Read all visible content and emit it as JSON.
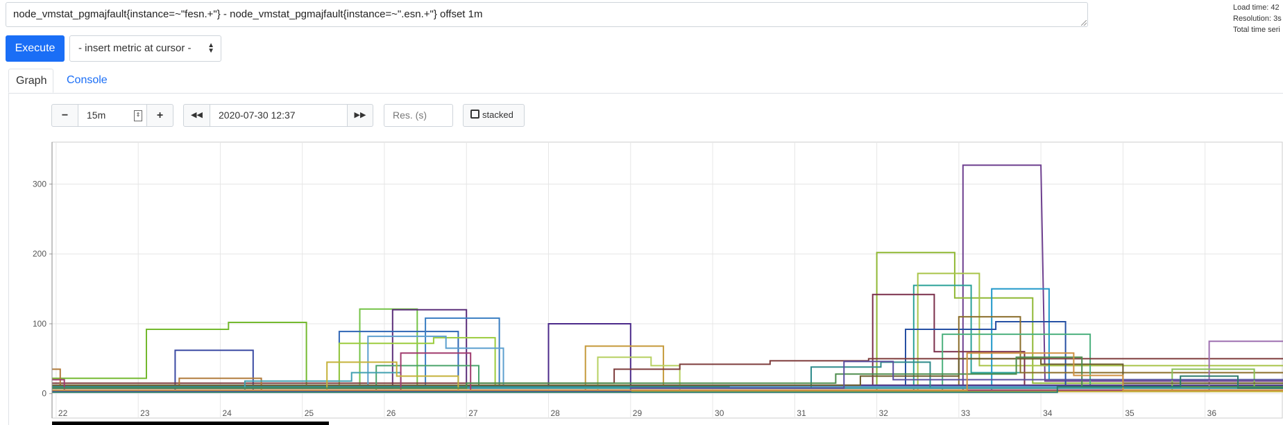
{
  "query": {
    "text": "node_vmstat_pgmajfault{instance=~\"fesn.+\"} - node_vmstat_pgmajfault{instance=~\".esn.+\"} offset 1m"
  },
  "stats": {
    "load_time": "Load time: 42",
    "resolution": "Resolution: 3s",
    "total_series": "Total time seri"
  },
  "toolbar": {
    "execute_label": "Execute",
    "insert_metric": "- insert metric at cursor -"
  },
  "tabs": [
    {
      "label": "Graph",
      "active": true
    },
    {
      "label": "Console",
      "active": false
    }
  ],
  "controls": {
    "minus": "−",
    "range": "15m",
    "plus": "+",
    "back": "◀◀",
    "end_time": "2020-07-30 12:37",
    "forward": "▶▶",
    "resolution_placeholder": "Res. (s)",
    "stacked_label": "stacked"
  },
  "colors": {
    "accent": "#1a6ef6",
    "grid": "#e6e6e6"
  },
  "chart_data": {
    "type": "line",
    "x_ticks": [
      "22",
      "23",
      "24",
      "25",
      "26",
      "27",
      "28",
      "29",
      "30",
      "31",
      "32",
      "33",
      "34",
      "35",
      "36"
    ],
    "y_ticks": [
      "0",
      "100",
      "200",
      "300"
    ],
    "xlim": [
      21.95,
      36.95
    ],
    "ylim": [
      -35,
      360
    ],
    "grid": true,
    "series": [
      {
        "color": "#6e3f8f",
        "points": [
          [
            21.95,
            3
          ],
          [
            32.9,
            3
          ],
          [
            33.05,
            3
          ],
          [
            33.05,
            327
          ],
          [
            34.0,
            327
          ],
          [
            34.05,
            18
          ],
          [
            36.95,
            18
          ]
        ]
      },
      {
        "color": "#8fb833",
        "points": [
          [
            21.95,
            3
          ],
          [
            32.0,
            3
          ],
          [
            32.0,
            202
          ],
          [
            32.95,
            202
          ],
          [
            32.95,
            137
          ],
          [
            33.9,
            137
          ],
          [
            33.9,
            15
          ],
          [
            36.95,
            15
          ]
        ]
      },
      {
        "color": "#2aa198",
        "points": [
          [
            21.95,
            5
          ],
          [
            32.45,
            5
          ],
          [
            32.45,
            155
          ],
          [
            33.15,
            155
          ],
          [
            33.15,
            30
          ],
          [
            36.95,
            30
          ]
        ]
      },
      {
        "color": "#a8c448",
        "points": [
          [
            21.95,
            5
          ],
          [
            32.5,
            5
          ],
          [
            32.5,
            172
          ],
          [
            33.25,
            172
          ],
          [
            33.25,
            40
          ],
          [
            36.95,
            40
          ]
        ]
      },
      {
        "color": "#1f97c9",
        "points": [
          [
            21.95,
            5
          ],
          [
            33.4,
            5
          ],
          [
            33.4,
            150
          ],
          [
            34.1,
            150
          ],
          [
            34.1,
            20
          ],
          [
            36.95,
            20
          ]
        ]
      },
      {
        "color": "#7a2e4a",
        "points": [
          [
            21.95,
            8
          ],
          [
            31.95,
            8
          ],
          [
            31.95,
            142
          ],
          [
            32.7,
            142
          ],
          [
            32.7,
            60
          ],
          [
            33.8,
            60
          ],
          [
            33.8,
            10
          ],
          [
            36.95,
            10
          ]
        ]
      },
      {
        "color": "#2650a3",
        "points": [
          [
            21.95,
            10
          ],
          [
            32.35,
            10
          ],
          [
            32.35,
            92
          ],
          [
            33.45,
            92
          ],
          [
            33.45,
            103
          ],
          [
            34.3,
            103
          ],
          [
            34.3,
            10
          ],
          [
            36.95,
            10
          ]
        ]
      },
      {
        "color": "#8a6d2a",
        "points": [
          [
            21.95,
            8
          ],
          [
            33.0,
            8
          ],
          [
            33.0,
            110
          ],
          [
            33.75,
            110
          ],
          [
            33.75,
            30
          ],
          [
            36.95,
            30
          ]
        ]
      },
      {
        "color": "#4bb07d",
        "points": [
          [
            21.95,
            5
          ],
          [
            32.8,
            5
          ],
          [
            32.8,
            85
          ],
          [
            34.6,
            85
          ],
          [
            34.6,
            12
          ],
          [
            36.95,
            12
          ]
        ]
      },
      {
        "color": "#73b92e",
        "points": [
          [
            21.95,
            22
          ],
          [
            23.1,
            22
          ],
          [
            23.1,
            92
          ],
          [
            24.1,
            92
          ],
          [
            24.1,
            102
          ],
          [
            25.05,
            102
          ],
          [
            25.05,
            8
          ],
          [
            36.95,
            8
          ]
        ]
      },
      {
        "color": "#3a4aa3",
        "points": [
          [
            21.95,
            5
          ],
          [
            23.45,
            5
          ],
          [
            23.45,
            62
          ],
          [
            24.4,
            62
          ],
          [
            24.4,
            5
          ],
          [
            36.95,
            5
          ]
        ]
      },
      {
        "color": "#74c346",
        "points": [
          [
            21.95,
            8
          ],
          [
            25.7,
            8
          ],
          [
            25.7,
            121
          ],
          [
            26.4,
            121
          ],
          [
            26.4,
            10
          ],
          [
            36.95,
            10
          ]
        ]
      },
      {
        "color": "#5b2e7a",
        "points": [
          [
            21.95,
            8
          ],
          [
            26.1,
            8
          ],
          [
            26.1,
            120
          ],
          [
            27.0,
            120
          ],
          [
            27.0,
            10
          ],
          [
            36.95,
            10
          ]
        ]
      },
      {
        "color": "#2f66b5",
        "points": [
          [
            21.95,
            8
          ],
          [
            25.45,
            8
          ],
          [
            25.45,
            89
          ],
          [
            26.9,
            89
          ],
          [
            26.9,
            10
          ],
          [
            36.95,
            10
          ]
        ]
      },
      {
        "color": "#3a7ec2",
        "points": [
          [
            21.95,
            10
          ],
          [
            26.5,
            10
          ],
          [
            26.5,
            108
          ],
          [
            27.4,
            108
          ],
          [
            27.4,
            10
          ],
          [
            36.95,
            10
          ]
        ]
      },
      {
        "color": "#9bcc3c",
        "points": [
          [
            21.95,
            10
          ],
          [
            25.45,
            10
          ],
          [
            25.45,
            72
          ],
          [
            26.6,
            72
          ],
          [
            26.6,
            80
          ],
          [
            27.35,
            80
          ],
          [
            27.35,
            12
          ],
          [
            36.95,
            12
          ]
        ]
      },
      {
        "color": "#4b2a8a",
        "points": [
          [
            21.95,
            8
          ],
          [
            28.0,
            8
          ],
          [
            28.0,
            100
          ],
          [
            29.0,
            100
          ],
          [
            29.0,
            12
          ],
          [
            36.95,
            12
          ]
        ]
      },
      {
        "color": "#c59a3a",
        "points": [
          [
            21.95,
            5
          ],
          [
            28.45,
            5
          ],
          [
            28.45,
            68
          ],
          [
            29.4,
            68
          ],
          [
            29.4,
            8
          ],
          [
            36.95,
            8
          ]
        ]
      },
      {
        "color": "#b6d060",
        "points": [
          [
            21.95,
            5
          ],
          [
            28.6,
            5
          ],
          [
            28.6,
            52
          ],
          [
            29.25,
            52
          ],
          [
            29.25,
            40
          ],
          [
            29.6,
            40
          ],
          [
            29.6,
            5
          ],
          [
            36.95,
            5
          ]
        ]
      },
      {
        "color": "#7d3b3b",
        "points": [
          [
            21.95,
            15
          ],
          [
            28.8,
            15
          ],
          [
            28.8,
            35
          ],
          [
            29.6,
            35
          ],
          [
            29.6,
            42
          ],
          [
            30.7,
            42
          ],
          [
            30.7,
            47
          ],
          [
            31.9,
            47
          ],
          [
            31.9,
            50
          ],
          [
            36.95,
            50
          ]
        ]
      },
      {
        "color": "#5c9fcf",
        "points": [
          [
            21.95,
            12
          ],
          [
            25.8,
            12
          ],
          [
            25.8,
            82
          ],
          [
            26.75,
            82
          ],
          [
            26.75,
            65
          ],
          [
            27.45,
            65
          ],
          [
            27.45,
            10
          ],
          [
            36.95,
            10
          ]
        ]
      },
      {
        "color": "#4aa36b",
        "points": [
          [
            21.95,
            5
          ],
          [
            25.9,
            5
          ],
          [
            25.9,
            40
          ],
          [
            27.15,
            40
          ],
          [
            27.15,
            8
          ],
          [
            36.95,
            8
          ]
        ]
      },
      {
        "color": "#9e6fb0",
        "points": [
          [
            21.95,
            3
          ],
          [
            36.05,
            3
          ],
          [
            36.05,
            75
          ],
          [
            36.95,
            75
          ]
        ]
      },
      {
        "color": "#88c057",
        "points": [
          [
            21.95,
            5
          ],
          [
            35.6,
            5
          ],
          [
            35.6,
            35
          ],
          [
            36.6,
            35
          ],
          [
            36.6,
            8
          ],
          [
            36.95,
            8
          ]
        ]
      },
      {
        "color": "#b07a3a",
        "points": [
          [
            21.95,
            35
          ],
          [
            22.05,
            35
          ],
          [
            22.05,
            12
          ],
          [
            23.5,
            12
          ],
          [
            23.5,
            22
          ],
          [
            24.5,
            22
          ],
          [
            24.5,
            5
          ],
          [
            36.95,
            5
          ]
        ]
      },
      {
        "color": "#2e8b8b",
        "points": [
          [
            21.95,
            10
          ],
          [
            30.2,
            10
          ],
          [
            30.2,
            8
          ],
          [
            31.2,
            8
          ],
          [
            31.2,
            38
          ],
          [
            32.05,
            38
          ],
          [
            32.05,
            45
          ],
          [
            32.65,
            45
          ],
          [
            32.65,
            8
          ],
          [
            36.95,
            8
          ]
        ]
      },
      {
        "color": "#6a5a2a",
        "points": [
          [
            21.95,
            12
          ],
          [
            31.8,
            12
          ],
          [
            31.8,
            25
          ],
          [
            33.0,
            25
          ],
          [
            33.0,
            50
          ],
          [
            34.0,
            50
          ],
          [
            34.0,
            42
          ],
          [
            35.0,
            42
          ],
          [
            35.0,
            15
          ],
          [
            36.95,
            15
          ]
        ]
      },
      {
        "color": "#40a0b0",
        "points": [
          [
            21.95,
            5
          ],
          [
            24.3,
            5
          ],
          [
            24.3,
            18
          ],
          [
            25.6,
            18
          ],
          [
            25.6,
            30
          ],
          [
            26.2,
            30
          ],
          [
            26.2,
            8
          ],
          [
            36.95,
            8
          ]
        ]
      },
      {
        "color": "#a03b6e",
        "points": [
          [
            21.95,
            20
          ],
          [
            22.1,
            20
          ],
          [
            22.1,
            5
          ],
          [
            26.2,
            5
          ],
          [
            26.2,
            58
          ],
          [
            27.05,
            58
          ],
          [
            27.05,
            5
          ],
          [
            36.95,
            5
          ]
        ]
      },
      {
        "color": "#c5b23a",
        "points": [
          [
            21.95,
            3
          ],
          [
            25.3,
            3
          ],
          [
            25.3,
            45
          ],
          [
            26.15,
            45
          ],
          [
            26.15,
            25
          ],
          [
            26.9,
            25
          ],
          [
            26.9,
            3
          ],
          [
            36.95,
            3
          ]
        ]
      },
      {
        "color": "#4c8c4c",
        "points": [
          [
            21.95,
            8
          ],
          [
            27.0,
            8
          ],
          [
            27.0,
            15
          ],
          [
            31.5,
            15
          ],
          [
            31.5,
            28
          ],
          [
            33.7,
            28
          ],
          [
            33.7,
            52
          ],
          [
            34.5,
            52
          ],
          [
            34.5,
            10
          ],
          [
            36.95,
            10
          ]
        ]
      },
      {
        "color": "#5a4fa0",
        "points": [
          [
            21.95,
            3
          ],
          [
            29.0,
            3
          ],
          [
            29.0,
            8
          ],
          [
            31.6,
            8
          ],
          [
            31.6,
            46
          ],
          [
            32.2,
            46
          ],
          [
            32.2,
            20
          ],
          [
            36.95,
            20
          ]
        ]
      },
      {
        "color": "#d09040",
        "points": [
          [
            21.95,
            5
          ],
          [
            33.1,
            5
          ],
          [
            33.1,
            58
          ],
          [
            34.4,
            58
          ],
          [
            34.4,
            26
          ],
          [
            35.0,
            26
          ],
          [
            35.0,
            5
          ],
          [
            36.95,
            5
          ]
        ]
      },
      {
        "color": "#2a7a6a",
        "points": [
          [
            21.95,
            2
          ],
          [
            34.2,
            2
          ],
          [
            34.2,
            10
          ],
          [
            35.7,
            10
          ],
          [
            35.7,
            25
          ],
          [
            36.4,
            25
          ],
          [
            36.4,
            8
          ],
          [
            36.95,
            8
          ]
        ]
      }
    ]
  }
}
